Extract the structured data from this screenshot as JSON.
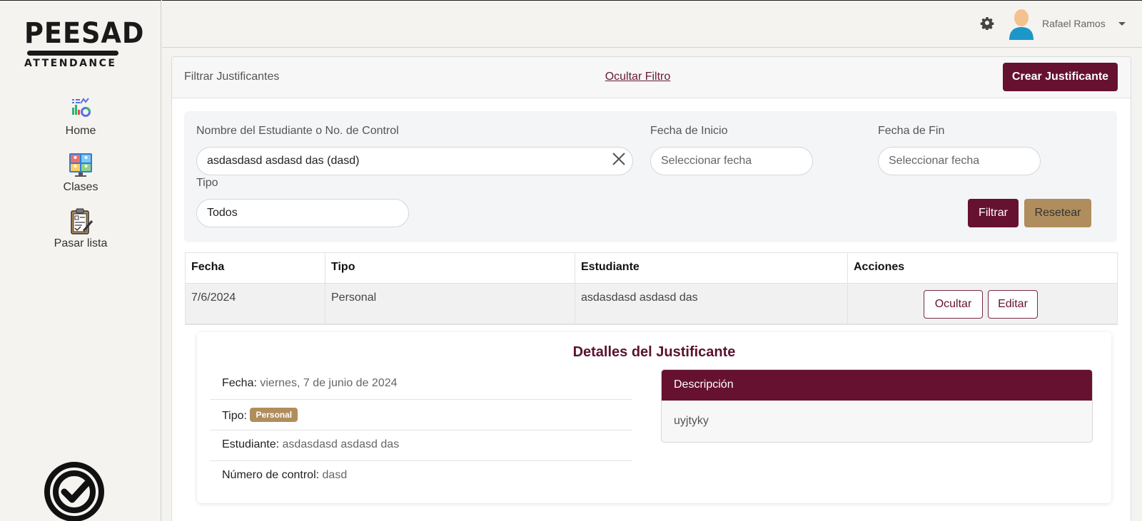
{
  "brand": {
    "name": "PEESAD",
    "tagline": "ATTENDANCE"
  },
  "sidebar": {
    "items": [
      {
        "label": "Home",
        "icon": "dashboard-chart-icon"
      },
      {
        "label": "Clases",
        "icon": "video-classroom-icon"
      },
      {
        "label": "Pasar lista",
        "icon": "clipboard-check-icon"
      }
    ]
  },
  "topbar": {
    "user_name": "Rafael Ramos"
  },
  "filter": {
    "title": "Filtrar Justificantes",
    "toggle_label": "Ocultar Filtro",
    "create_label": "Crear Justificante",
    "student_label": "Nombre del Estudiante o No. de Control",
    "student_value": "asdasdasd asdasd das (dasd)",
    "start_label": "Fecha de Inicio",
    "start_placeholder": "Seleccionar fecha",
    "end_label": "Fecha de Fin",
    "end_placeholder": "Seleccionar fecha",
    "type_label": "Tipo",
    "type_value": "Todos",
    "filter_button": "Filtrar",
    "reset_button": "Resetear"
  },
  "table": {
    "columns": [
      "Fecha",
      "Tipo",
      "Estudiante",
      "Acciones"
    ],
    "rows": [
      {
        "fecha": "7/6/2024",
        "tipo": "Personal",
        "estudiante": "asdasdasd asdasd das",
        "hide_label": "Ocultar",
        "edit_label": "Editar"
      }
    ]
  },
  "details": {
    "title": "Detalles del Justificante",
    "fecha_label": "Fecha:",
    "fecha_value": "viernes, 7 de junio de 2024",
    "tipo_label": "Tipo:",
    "tipo_value": "Personal",
    "estudiante_label": "Estudiante:",
    "estudiante_value": "asdasdasd asdasd das",
    "control_label": "Número de control:",
    "control_value": "dasd",
    "desc_label": "Descripción",
    "desc_value": "uyjtyky"
  },
  "colors": {
    "primary": "#66112f",
    "accent": "#b08d5c"
  }
}
